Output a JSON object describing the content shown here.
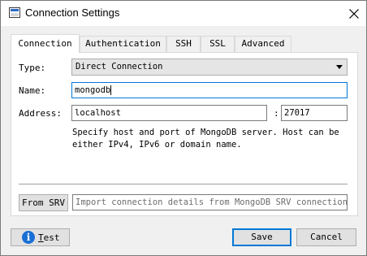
{
  "window": {
    "title": "Connection Settings",
    "app_icon": "window-icon",
    "close_icon": "close-icon"
  },
  "tabs": [
    {
      "label": "Connection",
      "active": true
    },
    {
      "label": "Authentication",
      "active": false
    },
    {
      "label": "SSH",
      "active": false
    },
    {
      "label": "SSL",
      "active": false
    },
    {
      "label": "Advanced",
      "active": false
    }
  ],
  "form": {
    "type_label": "Type:",
    "type_value": "Direct Connection",
    "name_label": "Name:",
    "name_value": "mongodb",
    "address_label": "Address:",
    "host_value": "localhost",
    "port_separator": ":",
    "port_value": "27017",
    "help_text": "Specify host and port of MongoDB server. Host can be either IPv4, IPv6 or domain name."
  },
  "srv": {
    "button_label": "From SRV",
    "input_placeholder": "Import connection details from MongoDB SRV connection…"
  },
  "footer": {
    "test_label": "Test",
    "save_label": "Save",
    "cancel_label": "Cancel",
    "info_icon": "info-icon"
  },
  "colors": {
    "dialog_bg": "#f0f0f0",
    "focus_border": "#0078d7",
    "info_icon_bg": "#1a6fd4"
  }
}
